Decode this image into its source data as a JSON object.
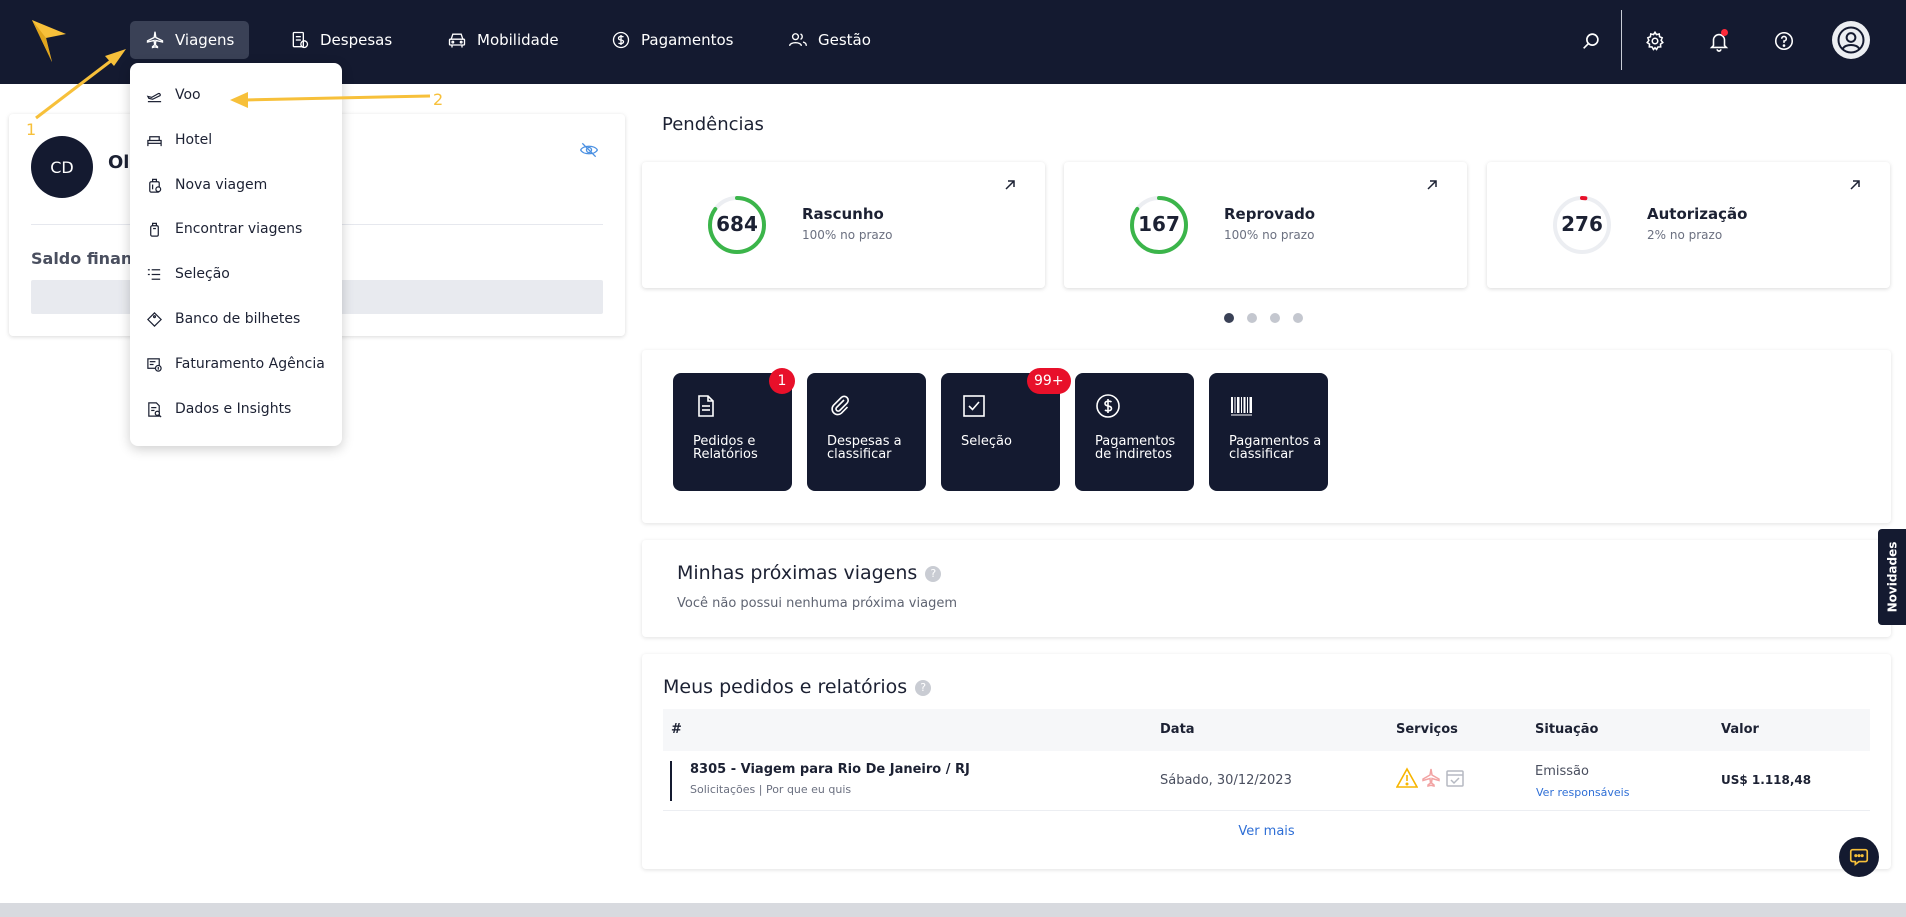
{
  "nav": {
    "items": [
      {
        "label": "Viagens",
        "icon": "plane-icon",
        "active": true
      },
      {
        "label": "Despesas",
        "icon": "expenses-icon"
      },
      {
        "label": "Mobilidade",
        "icon": "car-icon"
      },
      {
        "label": "Pagamentos",
        "icon": "dollar-icon"
      },
      {
        "label": "Gestão",
        "icon": "users-icon"
      }
    ],
    "right_icons": [
      "search-icon",
      "gear-icon",
      "bell-icon",
      "help-icon",
      "user-avatar-icon"
    ]
  },
  "viagens_menu": {
    "items": [
      {
        "label": "Voo",
        "icon": "flight-icon"
      },
      {
        "label": "Hotel",
        "icon": "bed-icon"
      },
      {
        "label": "Nova viagem",
        "icon": "luggage-icon"
      },
      {
        "label": "Encontrar viagens",
        "icon": "suitcase-icon"
      },
      {
        "label": "Seleção",
        "icon": "list-icon"
      },
      {
        "label": "Banco de bilhetes",
        "icon": "ticket-icon"
      },
      {
        "label": "Faturamento Agência",
        "icon": "invoice-icon"
      },
      {
        "label": "Dados e Insights",
        "icon": "report-icon"
      }
    ]
  },
  "annotations": {
    "step1": "1",
    "step2": "2"
  },
  "profile": {
    "initials": "CD",
    "greeting": "Ol",
    "saldo_label": "Saldo financ"
  },
  "pendencias": {
    "title": "Pendências",
    "cards": [
      {
        "value": "684",
        "label": "Rascunho",
        "sub": "100% no prazo",
        "ring_fraction": 0.85,
        "color": "#3bb54a"
      },
      {
        "value": "167",
        "label": "Reprovado",
        "sub": "100% no prazo",
        "ring_fraction": 0.85,
        "color": "#3bb54a"
      },
      {
        "value": "276",
        "label": "Autorização",
        "sub": "2% no prazo",
        "ring_fraction": 0.02,
        "color": "#e8102a"
      }
    ],
    "carousel_pages": 4,
    "carousel_active": 1
  },
  "shortcuts": [
    {
      "label": "Pedidos e Relatórios",
      "icon": "document-icon",
      "badge": "1"
    },
    {
      "label": "Despesas a classificar",
      "icon": "paperclip-icon",
      "badge": ""
    },
    {
      "label": "Seleção",
      "icon": "checkbox-icon",
      "badge": "99+"
    },
    {
      "label": "Pagamentos de indiretos",
      "icon": "dollar-circle-icon",
      "badge": ""
    },
    {
      "label": "Pagamentos a classificar",
      "icon": "barcode-icon",
      "badge": ""
    }
  ],
  "trips": {
    "title": "Minhas próximas viagens",
    "empty": "Você não possui nenhuma próxima viagem"
  },
  "orders": {
    "title": "Meus pedidos e relatórios",
    "columns": [
      "#",
      "Data",
      "Serviços",
      "Situação",
      "Valor"
    ],
    "rows": [
      {
        "title": "8305 - Viagem para Rio De Janeiro / RJ",
        "sub": "Solicitações | Por que eu quis",
        "date": "Sábado, 30/12/2023",
        "status": "Emissão",
        "status_link": "Ver responsáveis",
        "value": "US$ 1.118,48"
      }
    ],
    "more": "Ver mais"
  },
  "side_tab": "Novidades",
  "help_mark": "?",
  "colors": {
    "navy": "#141a30",
    "accent": "#f7c03a",
    "success": "#3bb54a",
    "danger": "#e8102a",
    "link": "#2f6fd6"
  }
}
